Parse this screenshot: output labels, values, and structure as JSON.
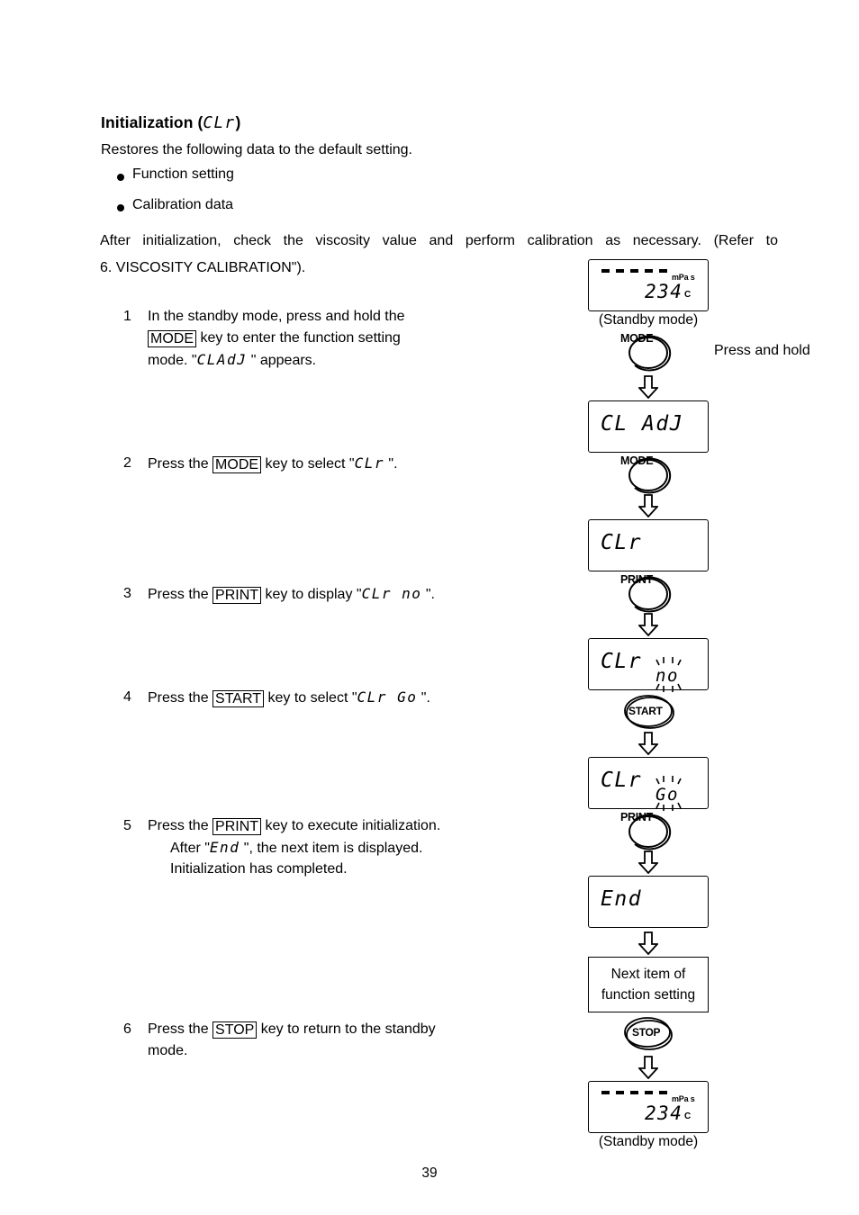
{
  "document": {
    "page_number": "39"
  },
  "heading": {
    "title_text": "Initialization (",
    "title_code": "CLr",
    "title_close": ")"
  },
  "intro": {
    "text": "Restores the following data to the default setting."
  },
  "bullets": [
    {
      "label": "Function setting"
    },
    {
      "label": "Calibration data"
    }
  ],
  "paragraph": {
    "line1": "After initialization, check the viscosity value and perform calibration as necessary. (Refer to",
    "line2": "6. VISCOSITY CALIBRATION\")."
  },
  "steps": [
    {
      "num": "1",
      "line1_a": "In the standby mode, press and hold the",
      "key": "MODE",
      "line2_b": "key to enter the function setting",
      "line3_a": "mode. \"",
      "line3_code": "CLAdJ",
      "line3_b": "\" appears."
    },
    {
      "num": "2",
      "pre": "Press the",
      "key": "MODE",
      "mid": "key to select \"",
      "code": "CLr",
      "post": "\"."
    },
    {
      "num": "3",
      "pre": "Press the",
      "key": "PRINT",
      "mid": "key to display \"",
      "code": "CLr  no",
      "post": "\"."
    },
    {
      "num": "4",
      "pre": "Press the",
      "key": "START",
      "mid": "key to select \"",
      "code": "CLr Go",
      "post": "\"."
    },
    {
      "num": "5",
      "pre": "Press the",
      "key": "PRINT",
      "mid": "key to execute initialization.",
      "line2_a": "After \"",
      "line2_code": "End",
      "line2_b": "\", the next item is displayed.",
      "line3": "Initialization has completed."
    },
    {
      "num": "6",
      "pre": "Press the",
      "key": "STOP",
      "mid": "key to return to the standby",
      "line2": "mode."
    }
  ],
  "flow": {
    "standby_top": {
      "unit_mpas": "mPa s",
      "value": "234",
      "unit_c": "C",
      "caption": "(Standby mode)"
    },
    "key_mode_1": {
      "label": "MODE",
      "note": "Press and hold"
    },
    "lcd_cladj": {
      "value": "CL AdJ"
    },
    "key_mode_2": {
      "label": "MODE"
    },
    "lcd_clr": {
      "value": "CLr"
    },
    "key_print_1": {
      "label": "PRINT"
    },
    "lcd_clr_no": {
      "value": "CLr",
      "value2": "no"
    },
    "key_start": {
      "label": "START"
    },
    "lcd_clr_go": {
      "value": "CLr",
      "value2": "Go"
    },
    "key_print_2": {
      "label": "PRINT"
    },
    "lcd_end": {
      "value": "End"
    },
    "next_item": {
      "line1": "Next item of",
      "line2": "function setting"
    },
    "key_stop": {
      "label": "STOP"
    },
    "standby_bottom": {
      "unit_mpas": "mPa s",
      "value": "234",
      "unit_c": "C",
      "caption": "(Standby mode)"
    }
  },
  "colors": {
    "ink": "#000000",
    "paper": "#ffffff"
  }
}
